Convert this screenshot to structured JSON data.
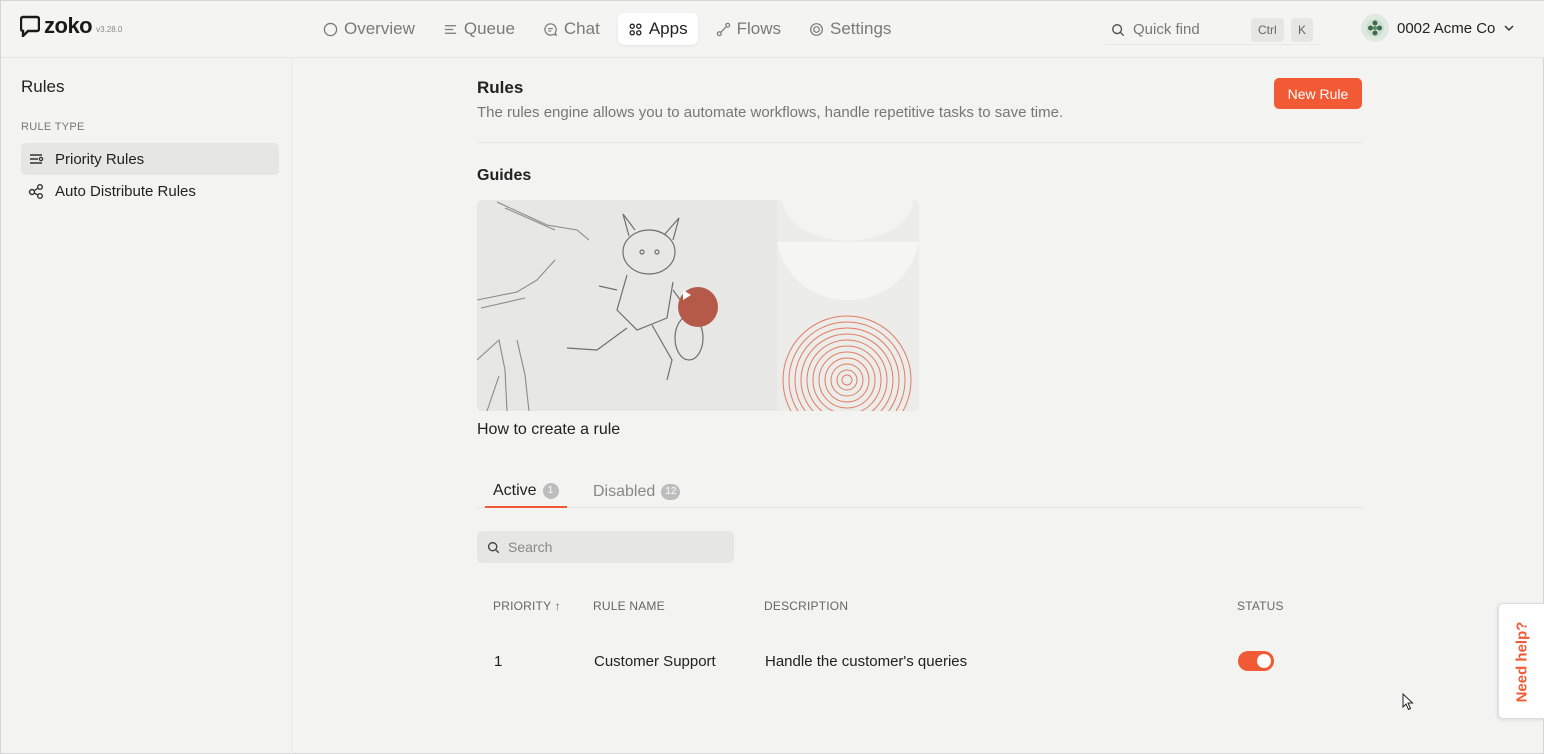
{
  "app": {
    "logo": "zoko",
    "version": "v3.28.0"
  },
  "nav": {
    "items": [
      {
        "label": "Overview",
        "icon": "circle-icon"
      },
      {
        "label": "Queue",
        "icon": "queue-icon"
      },
      {
        "label": "Chat",
        "icon": "chat-icon"
      },
      {
        "label": "Apps",
        "icon": "apps-grid-icon",
        "active": true
      },
      {
        "label": "Flows",
        "icon": "flows-icon"
      },
      {
        "label": "Settings",
        "icon": "gear-icon"
      }
    ]
  },
  "quick_find": {
    "placeholder": "Quick find",
    "shortcut": [
      "Ctrl",
      "K"
    ]
  },
  "account": {
    "name": "0002 Acme Co"
  },
  "sidebar": {
    "title": "Rules",
    "section": "RULE TYPE",
    "items": [
      {
        "label": "Priority Rules",
        "icon": "priority-rules-icon",
        "active": true
      },
      {
        "label": "Auto Distribute Rules",
        "icon": "distribute-icon"
      }
    ]
  },
  "main": {
    "title": "Rules",
    "description": "The rules engine allows you to automate workflows, handle repetitive tasks to save time.",
    "new_rule_label": "New Rule",
    "guides_title": "Guides",
    "video_caption": "How to create a rule",
    "tabs": [
      {
        "label": "Active",
        "count": "1",
        "active": true
      },
      {
        "label": "Disabled",
        "count": "12"
      }
    ],
    "search_placeholder": "Search",
    "table": {
      "headers": {
        "priority": "PRIORITY ↑",
        "rule_name": "RULE NAME",
        "description": "DESCRIPTION",
        "status": "STATUS"
      },
      "rows": [
        {
          "priority": "1",
          "rule_name": "Customer Support",
          "description": "Handle the customer's queries",
          "status_on": true
        }
      ]
    }
  },
  "help": {
    "label": "Need help?"
  },
  "colors": {
    "accent": "#f15a35",
    "background": "#f3f3f2"
  }
}
